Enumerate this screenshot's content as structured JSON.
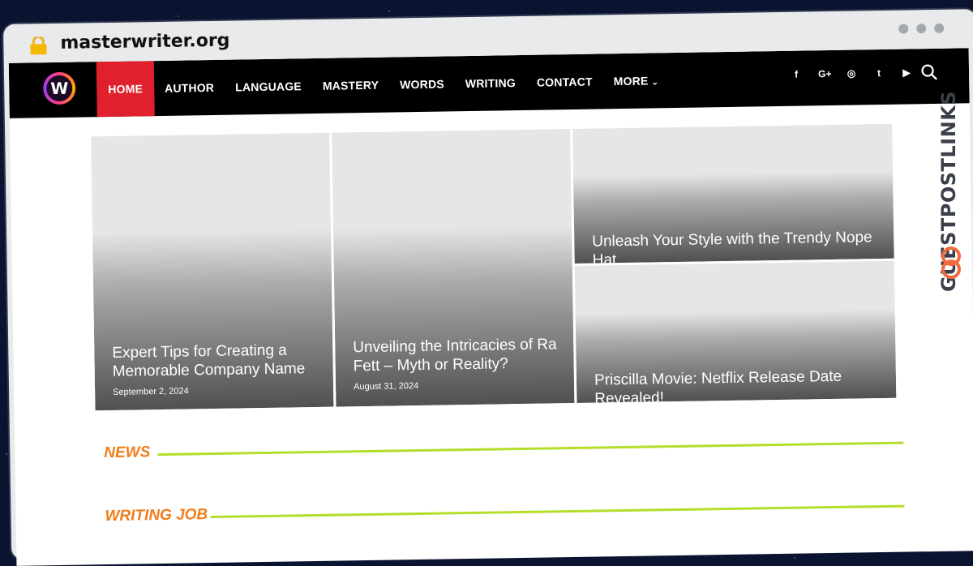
{
  "browser": {
    "url": "masterwriter.org"
  },
  "nav": {
    "logo_letter": "W",
    "items": [
      {
        "label": "HOME",
        "active": true
      },
      {
        "label": "AUTHOR"
      },
      {
        "label": "LANGUAGE"
      },
      {
        "label": "MASTERY"
      },
      {
        "label": "WORDS"
      },
      {
        "label": "WRITING"
      },
      {
        "label": "CONTACT"
      },
      {
        "label": "MORE"
      }
    ],
    "socials": [
      "f",
      "G+",
      "◎",
      "t",
      "▶"
    ]
  },
  "featured": [
    {
      "title": "Expert Tips for Creating a Memorable Company Name",
      "date": "September 2, 2024"
    },
    {
      "title": "Unveiling the Intricacies of Ra Fett – Myth or Reality?",
      "date": "August 31, 2024"
    },
    {
      "title": "Unleash Your Style with the Trendy Nope Hat"
    },
    {
      "title": "Priscilla Movie: Netflix Release Date Revealed!"
    }
  ],
  "sections": [
    "NEWS",
    "WRITING JOB"
  ],
  "watermark": "GUESTPOSTLINKS",
  "colors": {
    "nav_bg": "#000000",
    "active": "#e0202d",
    "section_label": "#f07d1b",
    "section_line": "#b3de2a"
  }
}
